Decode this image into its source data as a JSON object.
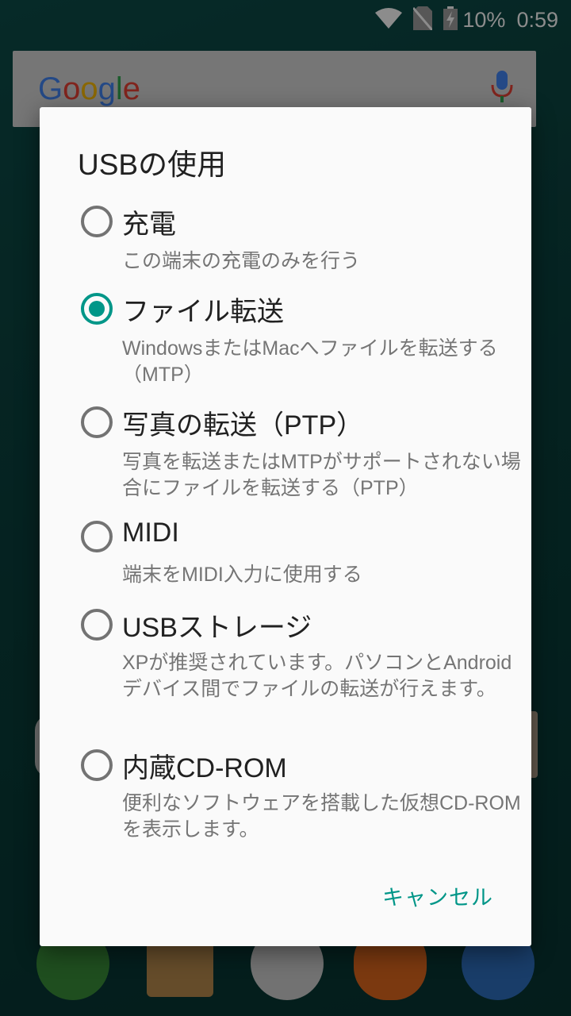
{
  "status_bar": {
    "battery_percent": "10%",
    "time": "0:59",
    "icons": [
      "wifi-icon",
      "no-sim-icon",
      "battery-charging-icon"
    ]
  },
  "home": {
    "search_logo": [
      "G",
      "o",
      "o",
      "g",
      "l",
      "e"
    ],
    "search_icons": [
      "mic-icon"
    ],
    "dock_icons": [
      "phone-icon",
      "contacts-icon",
      "apps-icon",
      "messaging-icon",
      "browser-icon"
    ]
  },
  "dialog": {
    "title": "USBの使用",
    "options": [
      {
        "label": "充電",
        "description": "この端末の充電のみを行う",
        "selected": false
      },
      {
        "label": "ファイル転送",
        "description": "WindowsまたはMacへファイルを転送する（MTP）",
        "selected": true
      },
      {
        "label": "写真の転送（PTP）",
        "description": "写真を転送またはMTPがサポートされない場合にファイルを転送する（PTP）",
        "selected": false
      },
      {
        "label": "MIDI",
        "description": "端末をMIDI入力に使用する",
        "selected": false
      },
      {
        "label": "USBストレージ",
        "description": "XPが推奨されています。パソコンとAndroidデバイス間でファイルの転送が行えます。",
        "selected": false
      },
      {
        "label": "内蔵CD-ROM",
        "description": "便利なソフトウェアを搭載した仮想CD-ROMを表示します。",
        "selected": false
      }
    ],
    "cancel_label": "キャンセル",
    "accent_color": "#009688"
  }
}
